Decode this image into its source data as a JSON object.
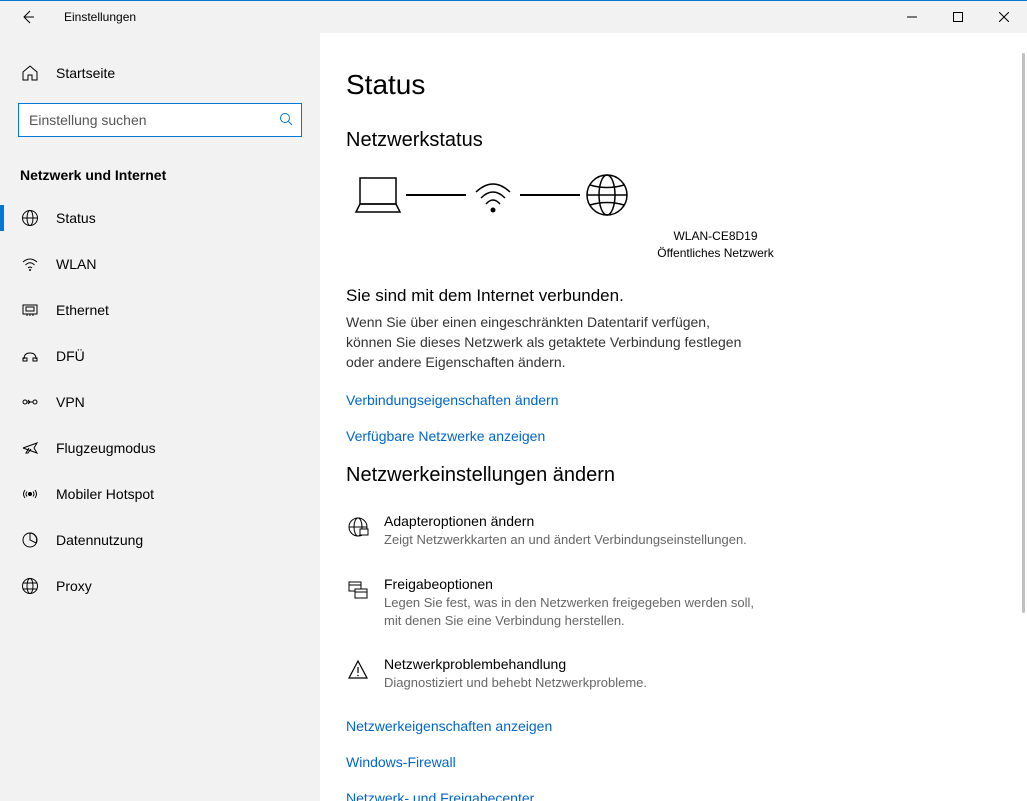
{
  "window": {
    "title": "Einstellungen"
  },
  "sidebar": {
    "home_label": "Startseite",
    "search_placeholder": "Einstellung suchen",
    "section_title": "Netzwerk und Internet",
    "items": [
      {
        "label": "Status",
        "icon": "status-icon",
        "active": true
      },
      {
        "label": "WLAN",
        "icon": "wifi-icon"
      },
      {
        "label": "Ethernet",
        "icon": "ethernet-icon"
      },
      {
        "label": "DFÜ",
        "icon": "dialup-icon"
      },
      {
        "label": "VPN",
        "icon": "vpn-icon"
      },
      {
        "label": "Flugzeugmodus",
        "icon": "airplane-icon"
      },
      {
        "label": "Mobiler Hotspot",
        "icon": "hotspot-icon"
      },
      {
        "label": "Datennutzung",
        "icon": "datausage-icon"
      },
      {
        "label": "Proxy",
        "icon": "proxy-icon"
      }
    ]
  },
  "main": {
    "title": "Status",
    "subheading": "Netzwerkstatus",
    "network_name": "WLAN-CE8D19",
    "network_type": "Öffentliches Netzwerk",
    "connected_heading": "Sie sind mit dem Internet verbunden.",
    "connected_body": "Wenn Sie über einen eingeschränkten Datentarif verfügen, können Sie dieses Netzwerk als getaktete Verbindung festlegen oder andere Eigenschaften ändern.",
    "link_properties": "Verbindungseigenschaften ändern",
    "link_available": "Verfügbare Netzwerke anzeigen",
    "settings_heading": "Netzwerkeinstellungen ändern",
    "options": [
      {
        "title": "Adapteroptionen ändern",
        "desc": "Zeigt Netzwerkkarten an und ändert Verbindungseinstellungen."
      },
      {
        "title": "Freigabeoptionen",
        "desc": "Legen Sie fest, was in den Netzwerken freigegeben werden soll, mit denen Sie eine Verbindung herstellen."
      },
      {
        "title": "Netzwerkproblembehandlung",
        "desc": "Diagnostiziert und behebt Netzwerkprobleme."
      }
    ],
    "link_netprops": "Netzwerkeigenschaften anzeigen",
    "link_firewall": "Windows-Firewall",
    "link_sharingcenter": "Netzwerk- und Freigabecenter"
  }
}
